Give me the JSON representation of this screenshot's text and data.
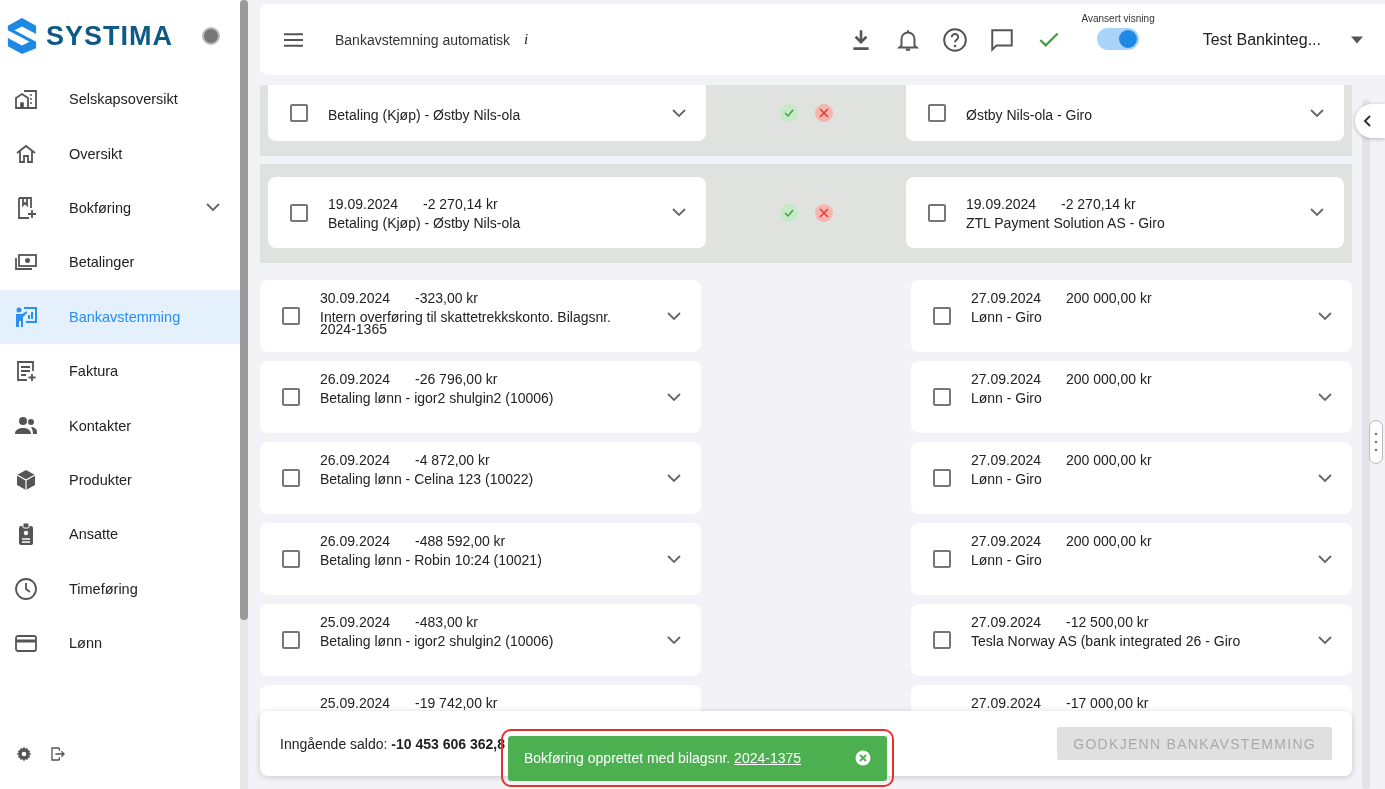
{
  "sidebar": {
    "logo": "SYSTIMA",
    "items": [
      {
        "label": "Selskapsoversikt",
        "selected": false
      },
      {
        "label": "Oversikt",
        "selected": false
      },
      {
        "label": "Bokføring",
        "selected": false,
        "expandable": true
      },
      {
        "label": "Betalinger",
        "selected": false
      },
      {
        "label": "Bankavstemming",
        "selected": true
      },
      {
        "label": "Faktura",
        "selected": false
      },
      {
        "label": "Kontakter",
        "selected": false
      },
      {
        "label": "Produkter",
        "selected": false
      },
      {
        "label": "Ansatte",
        "selected": false
      },
      {
        "label": "Timeføring",
        "selected": false
      },
      {
        "label": "Lønn",
        "selected": false
      }
    ]
  },
  "topbar": {
    "title": "Bankavstemning automatisk",
    "info": "i",
    "toggle": {
      "label": "Avansert visning",
      "on": true
    },
    "company": "Test Bankinteg..."
  },
  "matched_pairs": [
    {
      "bank": {
        "description": "Betaling (Kjøp) - Østby Nils-ola",
        "checked": false
      },
      "ledger": {
        "description": "Østby Nils-ola - Giro",
        "checked": false
      }
    },
    {
      "bank": {
        "date": "19.09.2024",
        "amount": "-2 270,14 kr",
        "description": "Betaling (Kjøp) - Østby Nils-ola",
        "checked": false
      },
      "ledger": {
        "date": "19.09.2024",
        "amount": "-2 270,14 kr",
        "description": "ZTL Payment Solution AS - Giro",
        "checked": false
      }
    }
  ],
  "rows": [
    {
      "bank": {
        "date": "30.09.2024",
        "amount": "-323,00 kr",
        "description": "Intern overføring til skattetrekkskonto. Bilagsnr. 2024-1365",
        "checked": false
      },
      "ledger": {
        "date": "27.09.2024",
        "amount": "200 000,00 kr",
        "description": "Lønn - Giro",
        "checked": false
      }
    },
    {
      "bank": {
        "date": "26.09.2024",
        "amount": "-26 796,00 kr",
        "description": "Betaling lønn - igor2 shulgin2 (10006)",
        "checked": false
      },
      "ledger": {
        "date": "27.09.2024",
        "amount": "200 000,00 kr",
        "description": "Lønn - Giro",
        "checked": false
      }
    },
    {
      "bank": {
        "date": "26.09.2024",
        "amount": "-4 872,00 kr",
        "description": "Betaling lønn - Celina 123 (10022)",
        "checked": false
      },
      "ledger": {
        "date": "27.09.2024",
        "amount": "200 000,00 kr",
        "description": "Lønn - Giro",
        "checked": false
      }
    },
    {
      "bank": {
        "date": "26.09.2024",
        "amount": "-488 592,00 kr",
        "description": "Betaling lønn - Robin 10:24 (10021)",
        "checked": false
      },
      "ledger": {
        "date": "27.09.2024",
        "amount": "200 000,00 kr",
        "description": "Lønn - Giro",
        "checked": false
      }
    },
    {
      "bank": {
        "date": "25.09.2024",
        "amount": "-483,00 kr",
        "description": "Betaling lønn - igor2 shulgin2 (10006)",
        "checked": false
      },
      "ledger": {
        "date": "27.09.2024",
        "amount": "-12 500,00 kr",
        "description": "Tesla Norway AS (bank integrated 26 - Giro",
        "checked": false
      }
    },
    {
      "bank": {
        "date": "25.09.2024",
        "amount": "-19 742,00 kr"
      },
      "ledger": {
        "date": "27.09.2024",
        "amount": "-17 000,00 kr"
      }
    }
  ],
  "footer": {
    "balance_label": "Inngående saldo:",
    "balance_value": "-10 453 606 362,8",
    "approve_button": {
      "label": "GODKJENN BANKAVSTEMMING",
      "disabled": true
    }
  },
  "toast": {
    "text": "Bokføring opprettet med bilagsnr.",
    "link": "2024-1375"
  }
}
